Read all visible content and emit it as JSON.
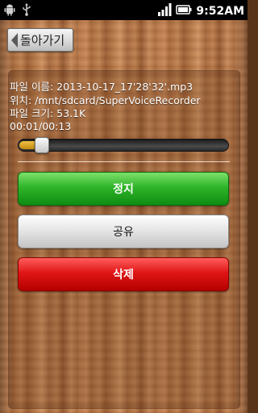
{
  "status_bar": {
    "left_icons": [
      "android-icon",
      "usb-icon"
    ],
    "time": "9:52AM"
  },
  "back_button": {
    "label": "돌아가기"
  },
  "file_info": {
    "filename_line": "파일 이름: 2013-10-17_17'28'32'.mp3",
    "location_line": "위치: /mnt/sdcard/SuperVoiceRecorder",
    "size_line": "파일 크기: 53.1K",
    "time_line": "00:01/00:13"
  },
  "playback": {
    "position_fraction": 0.077
  },
  "buttons": {
    "stop_label": "정지",
    "share_label": "공유",
    "delete_label": "삭제"
  },
  "colors": {
    "stop": "#2fb52a",
    "share": "#e3e3e3",
    "delete": "#e01616",
    "seek_fill": "#f0c040"
  }
}
